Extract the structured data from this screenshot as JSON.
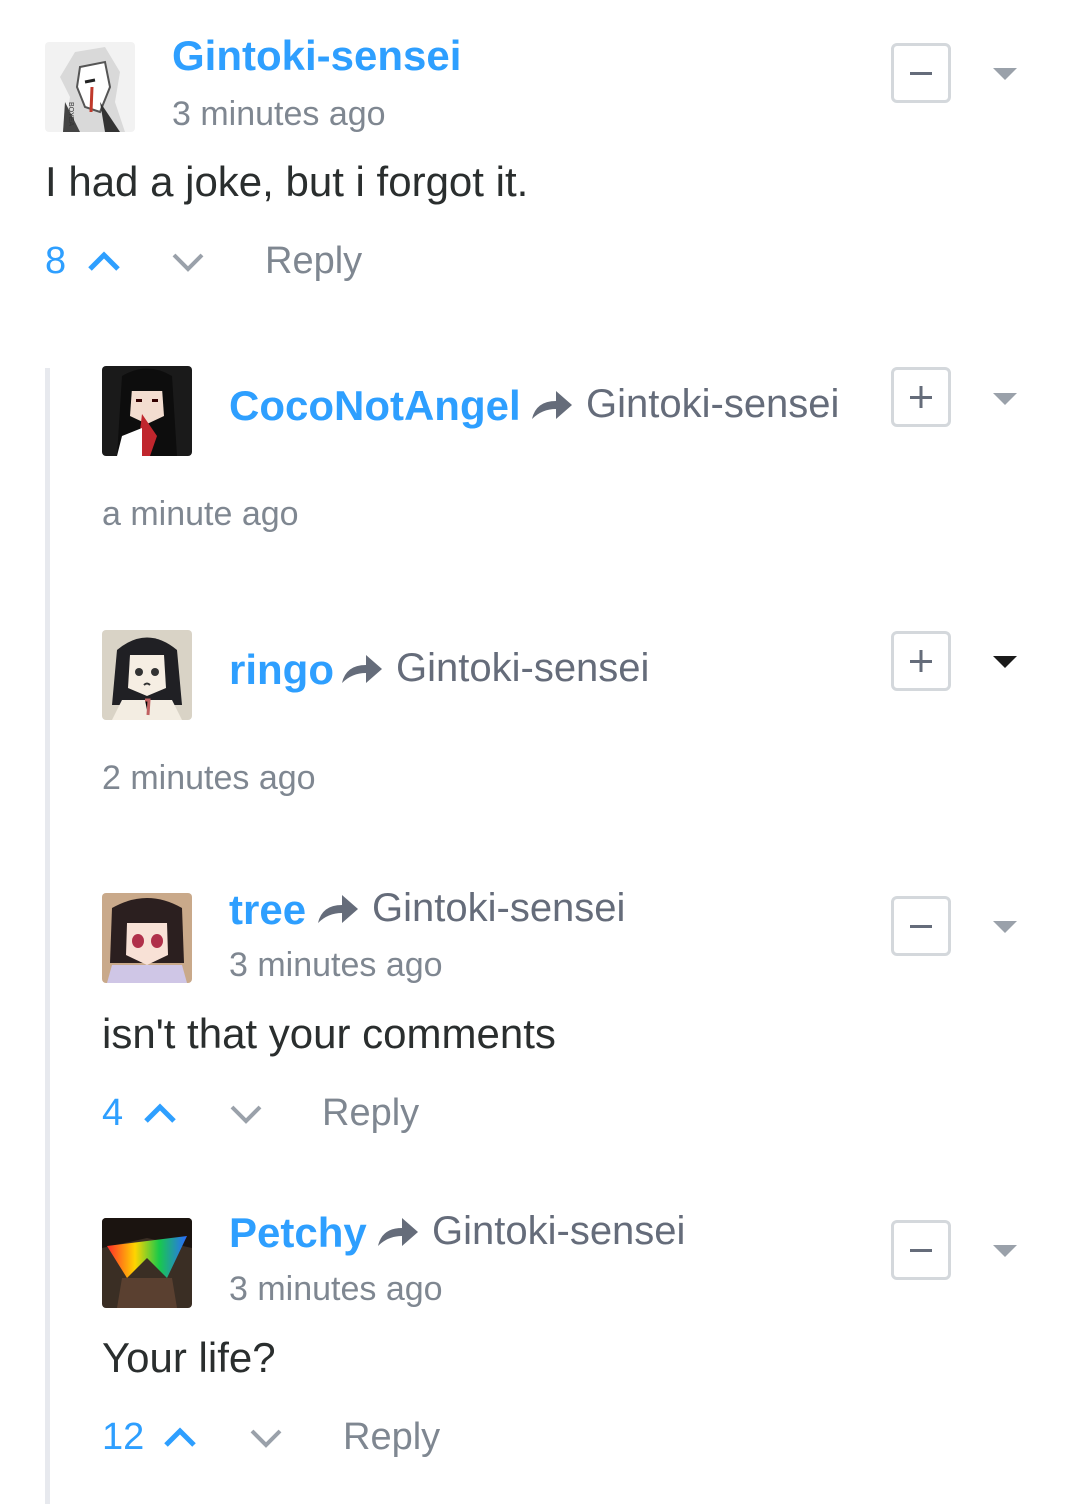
{
  "comments": [
    {
      "author": "Gintoki-sensei",
      "time": "3 minutes ago",
      "text": "I had a joke, but i forgot it.",
      "votes": "8",
      "reply_label": "Reply",
      "toggle": "−",
      "avatar_watermark": "BOYEA"
    },
    {
      "author": "CocoNotAngel",
      "reply_to": "Gintoki-sensei",
      "time": "a minute ago",
      "toggle": "+"
    },
    {
      "author": "ringo",
      "reply_to": "Gintoki-sensei",
      "time": "2 minutes ago",
      "toggle": "+"
    },
    {
      "author": "tree",
      "reply_to": "Gintoki-sensei",
      "time": "3 minutes ago",
      "text": "isn't that your comments",
      "votes": "4",
      "reply_label": "Reply",
      "toggle": "−"
    },
    {
      "author": "Petchy",
      "reply_to": "Gintoki-sensei",
      "time": "3 minutes ago",
      "text": "Your life?",
      "votes": "12",
      "reply_label": "Reply",
      "toggle": "−"
    }
  ],
  "icons": {
    "upvote": "chevron-up-icon",
    "downvote": "chevron-down-icon",
    "reply_to": "reply-arrow-icon",
    "menu": "caret-down-icon"
  },
  "colors": {
    "author": "#2e9fff",
    "votes": "#2e9fff",
    "meta": "#7f8791",
    "text": "#2a2e2e",
    "border": "#d4d8dc"
  }
}
